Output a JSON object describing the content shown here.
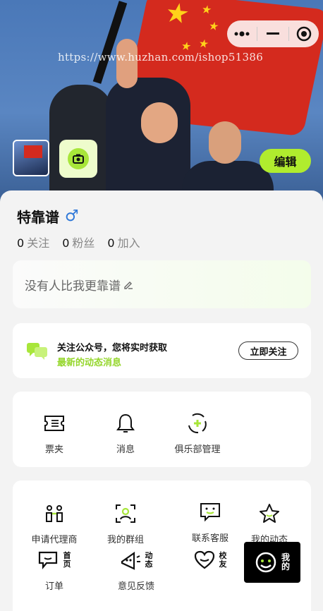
{
  "watermark": "https://www.huzhan.com/ishop51386",
  "capsule": {
    "more_icon": "more-dots-icon",
    "minimize_icon": "minimize-icon",
    "close_icon": "target-circle-icon"
  },
  "header": {
    "edit_label": "编辑"
  },
  "profile": {
    "name": "特靠谱",
    "gender_symbol": "♂",
    "stats": [
      {
        "count": "0",
        "label": "关注"
      },
      {
        "count": "0",
        "label": "粉丝"
      },
      {
        "count": "0",
        "label": "加入"
      }
    ],
    "bio": "没有人比我更靠谱"
  },
  "follow_card": {
    "title": "关注公众号，您将实时获取",
    "subtitle": "最新的动态消息",
    "button": "立即关注"
  },
  "menu_top": [
    {
      "label": "票夹",
      "icon": "ticket-icon"
    },
    {
      "label": "消息",
      "icon": "bell-icon"
    },
    {
      "label": "俱乐部管理",
      "icon": "club-manage-icon"
    }
  ],
  "menu_bottom": [
    {
      "label": "申请代理商",
      "icon": "agent-icon"
    },
    {
      "label": "我的群组",
      "icon": "group-icon"
    },
    {
      "label": "联系客服",
      "icon": "service-icon"
    },
    {
      "label": "我的动态",
      "icon": "star-icon"
    },
    {
      "label": "订单",
      "icon": "order-icon"
    },
    {
      "label": "意见反馈",
      "icon": "feedback-icon"
    }
  ],
  "floating_tabs": [
    {
      "label_line1": "首",
      "label_line2": "页"
    },
    {
      "label_line1": "动",
      "label_line2": "态"
    },
    {
      "label_line1": "校",
      "label_line2": "友"
    },
    {
      "label_line1": "我",
      "label_line2": "的"
    }
  ],
  "colors": {
    "accent": "#b0ec2e",
    "accent_text": "#94d62a",
    "gender": "#2f78d8",
    "flag": "#d42a1e"
  }
}
